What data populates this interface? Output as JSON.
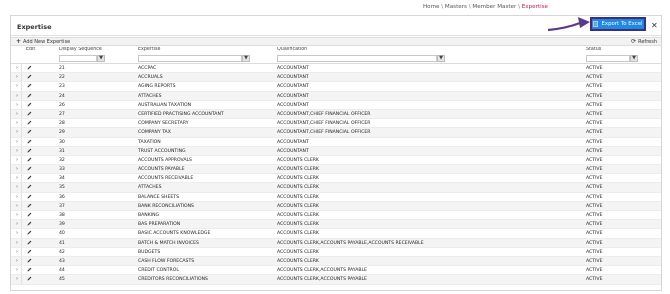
{
  "breadcrumb": {
    "items": [
      "Home",
      "Masters",
      "Member Master"
    ],
    "separator": "\\",
    "current": "Expertise"
  },
  "panel": {
    "title": "Expertise"
  },
  "toolbar": {
    "add_label": "Add New Expertise",
    "refresh_label": "Refresh",
    "export_label": "Export To Excel",
    "close_glyph": "✕"
  },
  "grid": {
    "headers": {
      "edit": "Edit",
      "sequence": "Display Sequence",
      "expertise": "Expertise",
      "qualification": "Qualification",
      "status": "Status"
    },
    "filters": {
      "sequence": "",
      "expertise": "",
      "qualification": "",
      "status": ""
    },
    "rows": [
      {
        "seq": "21",
        "expertise": "ACCPAC",
        "qualification": "ACCOUNTANT",
        "status": "ACTIVE"
      },
      {
        "seq": "22",
        "expertise": "ACCRUALS",
        "qualification": "ACCOUNTANT",
        "status": "ACTIVE"
      },
      {
        "seq": "23",
        "expertise": "AGING REPORTS",
        "qualification": "ACCOUNTANT",
        "status": "ACTIVE"
      },
      {
        "seq": "24",
        "expertise": "ATTACHES",
        "qualification": "ACCOUNTANT",
        "status": "ACTIVE"
      },
      {
        "seq": "26",
        "expertise": "AUSTRALIAN TAXATION",
        "qualification": "ACCOUNTANT",
        "status": "ACTIVE"
      },
      {
        "seq": "27",
        "expertise": "CERTIFIED PRACTISING ACCOUNTANT",
        "qualification": "ACCOUNTANT,CHIEF FINANCIAL OFFICER",
        "status": "ACTIVE"
      },
      {
        "seq": "28",
        "expertise": "COMPANY SECRETARY",
        "qualification": "ACCOUNTANT,CHIEF FINANCIAL OFFICER",
        "status": "ACTIVE"
      },
      {
        "seq": "29",
        "expertise": "COMPANY TAX",
        "qualification": "ACCOUNTANT,CHIEF FINANCIAL OFFICER",
        "status": "ACTIVE"
      },
      {
        "seq": "30",
        "expertise": "TAXATION",
        "qualification": "ACCOUNTANT",
        "status": "ACTIVE"
      },
      {
        "seq": "31",
        "expertise": "TRUST ACCOUNTING",
        "qualification": "ACCOUNTANT",
        "status": "ACTIVE"
      },
      {
        "seq": "32",
        "expertise": "ACCOUNTS APPROVALS",
        "qualification": "ACCOUNTS CLERK",
        "status": "ACTIVE"
      },
      {
        "seq": "33",
        "expertise": "ACCOUNTS PAYABLE",
        "qualification": "ACCOUNTS CLERK",
        "status": "ACTIVE"
      },
      {
        "seq": "34",
        "expertise": "ACCOUNTS RECEIVABLE",
        "qualification": "ACCOUNTS CLERK",
        "status": "ACTIVE"
      },
      {
        "seq": "35",
        "expertise": "ATTACHES",
        "qualification": "ACCOUNTS CLERK",
        "status": "ACTIVE"
      },
      {
        "seq": "36",
        "expertise": "BALANCE SHEETS",
        "qualification": "ACCOUNTS CLERK",
        "status": "ACTIVE"
      },
      {
        "seq": "37",
        "expertise": "BANK RECONCILIATIONS",
        "qualification": "ACCOUNTS CLERK",
        "status": "ACTIVE"
      },
      {
        "seq": "38",
        "expertise": "BANKING",
        "qualification": "ACCOUNTS CLERK",
        "status": "ACTIVE"
      },
      {
        "seq": "39",
        "expertise": "BAS PREPARATION",
        "qualification": "ACCOUNTS CLERK",
        "status": "ACTIVE"
      },
      {
        "seq": "40",
        "expertise": "BASIC ACCOUNTS KNOWLEDGE",
        "qualification": "ACCOUNTS CLERK",
        "status": "ACTIVE"
      },
      {
        "seq": "41",
        "expertise": "BATCH & MATCH INVOICES",
        "qualification": "ACCOUNTS CLERK,ACCOUNTS PAYABLE,ACCOUNTS RECEIVABLE",
        "status": "ACTIVE"
      },
      {
        "seq": "42",
        "expertise": "BUDGETS",
        "qualification": "ACCOUNTS CLERK",
        "status": "ACTIVE"
      },
      {
        "seq": "43",
        "expertise": "CASH FLOW FORECASTS",
        "qualification": "ACCOUNTS CLERK",
        "status": "ACTIVE"
      },
      {
        "seq": "44",
        "expertise": "CREDIT CONTROL",
        "qualification": "ACCOUNTS CLERK,ACCOUNTS PAYABLE",
        "status": "ACTIVE"
      },
      {
        "seq": "45",
        "expertise": "CREDITORS RECONCILIATIONS",
        "qualification": "ACCOUNTS CLERK,ACCOUNTS PAYABLE",
        "status": "ACTIVE"
      }
    ]
  },
  "icons": {
    "expand": "chevron-right-icon",
    "edit": "pencil-icon",
    "filter": "filter-icon",
    "export": "document-icon",
    "close": "close-icon",
    "refresh": "refresh-icon",
    "add": "plus-icon"
  },
  "colors": {
    "accent": "#1e88e5",
    "highlight_border": "#3f2c7d",
    "breadcrumb_current": "#c2185b"
  }
}
